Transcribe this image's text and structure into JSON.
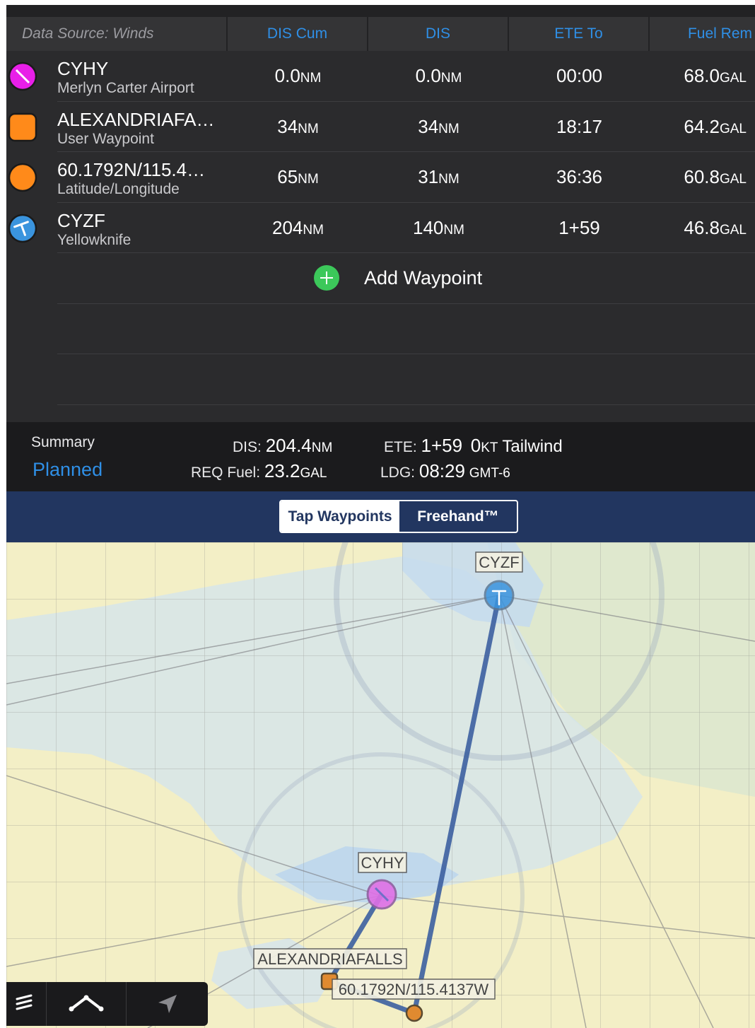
{
  "header": {
    "source": "Data Source: Winds",
    "col1": "DIS Cum",
    "col2": "DIS",
    "col3": "ETE To",
    "col4": "Fuel Rem"
  },
  "waypoints": [
    {
      "name": "CYHY",
      "type": "Merlyn Carter Airport",
      "dis_cum": "0.0",
      "dis": "0.0",
      "ete": "00:00",
      "fuel": "68.0",
      "icon": "airport-restricted-icon"
    },
    {
      "name": "ALEXANDRIAFA…",
      "type": "User Waypoint",
      "dis_cum": "34",
      "dis": "34",
      "ete": "18:17",
      "fuel": "64.2",
      "icon": "user-waypoint-icon"
    },
    {
      "name": "60.1792N/115.4…",
      "type": "Latitude/Longitude",
      "dis_cum": "65",
      "dis": "31",
      "ete": "36:36",
      "fuel": "60.8",
      "icon": "latlon-waypoint-icon"
    },
    {
      "name": "CYZF",
      "type": "Yellowknife",
      "dis_cum": "204",
      "dis": "140",
      "ete": "1+59",
      "fuel": "46.8",
      "icon": "airport-icon"
    }
  ],
  "units": {
    "distance": "NM",
    "fuel": "GAL"
  },
  "add_waypoint": "Add Waypoint",
  "summary": {
    "label": "Summary",
    "mode": "Planned",
    "dis_label": "DIS:",
    "dis_value": "204.4",
    "dis_unit": "NM",
    "fuel_label": "REQ Fuel:",
    "fuel_value": "23.2",
    "fuel_unit": "GAL",
    "ete_label": "ETE:",
    "ete_value": "1+59",
    "wind_value": "0",
    "wind_unit": "KT",
    "wind_text": "Tailwind",
    "ldg_label": "LDG:",
    "ldg_value": "08:29",
    "ldg_tz": "GMT-6"
  },
  "segmented": {
    "option1": "Tap Waypoints",
    "option2": "Freehand™",
    "selected": "Tap Waypoints"
  },
  "map": {
    "labels": {
      "cyzf": "CYZF",
      "cyhy": "CYHY",
      "alex": "ALEXANDRIAFALLS",
      "latlon": "60.1792N/115.4137W"
    }
  },
  "colors": {
    "accent": "#2f8fe6",
    "route": "#3c5fa0",
    "add": "#3cc85a",
    "nav_bar": "#223660",
    "orange": "#ff8a1a",
    "magenta": "#e81fe8"
  }
}
